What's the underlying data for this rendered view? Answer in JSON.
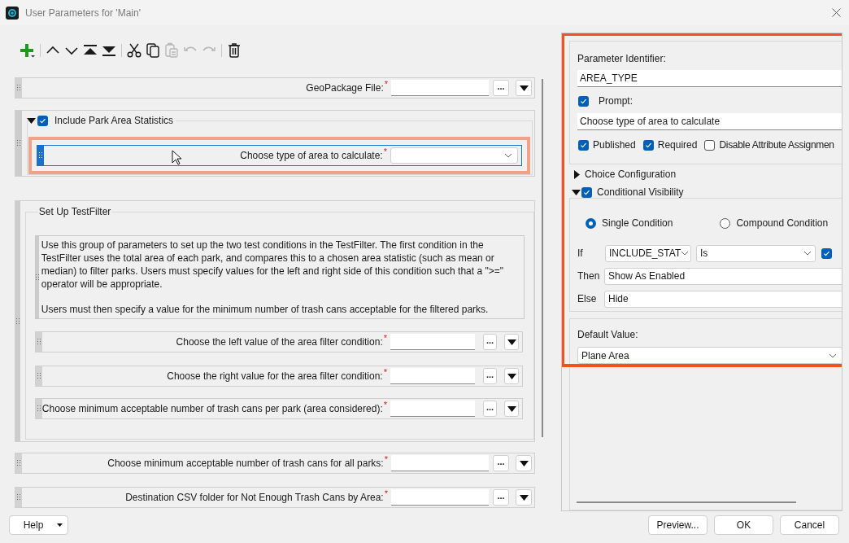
{
  "window": {
    "title": "User Parameters for 'Main'"
  },
  "toolbar_groups": [
    [
      {
        "kind": "add",
        "disabled": false
      }
    ],
    [
      {
        "kind": "move_up",
        "disabled": false
      },
      {
        "kind": "move_down",
        "disabled": false
      },
      {
        "kind": "move_top",
        "disabled": false
      },
      {
        "kind": "move_bottom",
        "disabled": false
      }
    ],
    [
      {
        "kind": "cut",
        "disabled": false
      },
      {
        "kind": "copy",
        "disabled": false
      },
      {
        "kind": "paste",
        "disabled": true
      },
      {
        "kind": "undo",
        "disabled": true
      },
      {
        "kind": "redo",
        "disabled": true
      }
    ],
    [
      {
        "kind": "delete",
        "disabled": false
      }
    ]
  ],
  "parameters": [
    {
      "kind": "field",
      "label": "GeoPackage File:$^{*}$",
      "dropdown": false,
      "browse": "...",
      "selected": false
    },
    {
      "kind": "group",
      "title": "Include Park Area Statistics",
      "checked": true,
      "expanded": true,
      "children": [
        {
          "kind": "field",
          "label": "Choose type of area to calculate:$^{*}$",
          "dropdown": true,
          "selected": true
        }
      ]
    },
    {
      "kind": "section",
      "title": "Set Up TestFilter",
      "children": [
        {
          "kind": "note",
          "paragraphs": [
            "Use this group of parameters to set up the two test conditions in the TestFilter. The first condition in the TestFilter uses the total area of each park, and compares this to a chosen area statistic (such as mean or median) to filter parks. Users must specify values for the left and right side of this condition such that a \">=\" operator will be appropriate.",
            "Users must then specify a value for the minimum number of trash cans acceptable for the filtered parks."
          ]
        },
        {
          "kind": "field",
          "label": "Choose the left value of the area filter condition:$^{*}$",
          "dropdown": false,
          "browse": "...",
          "selected": false
        },
        {
          "kind": "field",
          "label": "Choose the right value for the area filter condition:$^{*}$",
          "dropdown": false,
          "browse": "...",
          "selected": false
        },
        {
          "kind": "field",
          "label": "Choose minimum acceptable number of trash cans per park (area considered):$^{*}$",
          "dropdown": false,
          "browse": "...",
          "selected": false
        }
      ]
    },
    {
      "kind": "field",
      "label": "Choose minimum acceptable number of trash cans for all parks:$^{*}$",
      "dropdown": false,
      "browse": "...",
      "selected": false
    },
    {
      "kind": "field",
      "label": "Destination CSV folder for Not Enough Trash Cans by Area:$^{*}$",
      "dropdown": false,
      "browse": "...",
      "selected": false
    }
  ],
  "editor": {
    "identifier_label": "Parameter Identifier:",
    "identifier": "AREA_TYPE",
    "prompt": {
      "label": "Prompt:",
      "checked": true,
      "value": "Choose type of area to calculate"
    },
    "options": [
      {
        "label": "Published",
        "checked": true
      },
      {
        "label": "Required",
        "checked": true
      },
      {
        "label": "Disable Attribute Assignmen",
        "checked": false
      }
    ],
    "choice_configuration": {
      "title": "Choice Configuration",
      "expanded": false
    },
    "conditional_visibility": {
      "title": "Conditional Visibility",
      "expanded": true,
      "checked": true,
      "modes": [
        {
          "label": "Single Condition",
          "selected": true
        },
        {
          "label": "Compound Condition",
          "selected": false
        }
      ],
      "if": {
        "label": "If",
        "attribute": "INCLUDE_STAT",
        "operator": "Is",
        "checked": true
      },
      "then": {
        "label": "Then",
        "value": "Show As Enabled"
      },
      "else": {
        "label": "Else",
        "value": "Hide"
      }
    },
    "default": {
      "label": "Default Value:",
      "value": "Plane Area"
    }
  },
  "footer": {
    "help": "Help",
    "buttons": [
      "Preview...",
      "OK",
      "Cancel"
    ]
  }
}
